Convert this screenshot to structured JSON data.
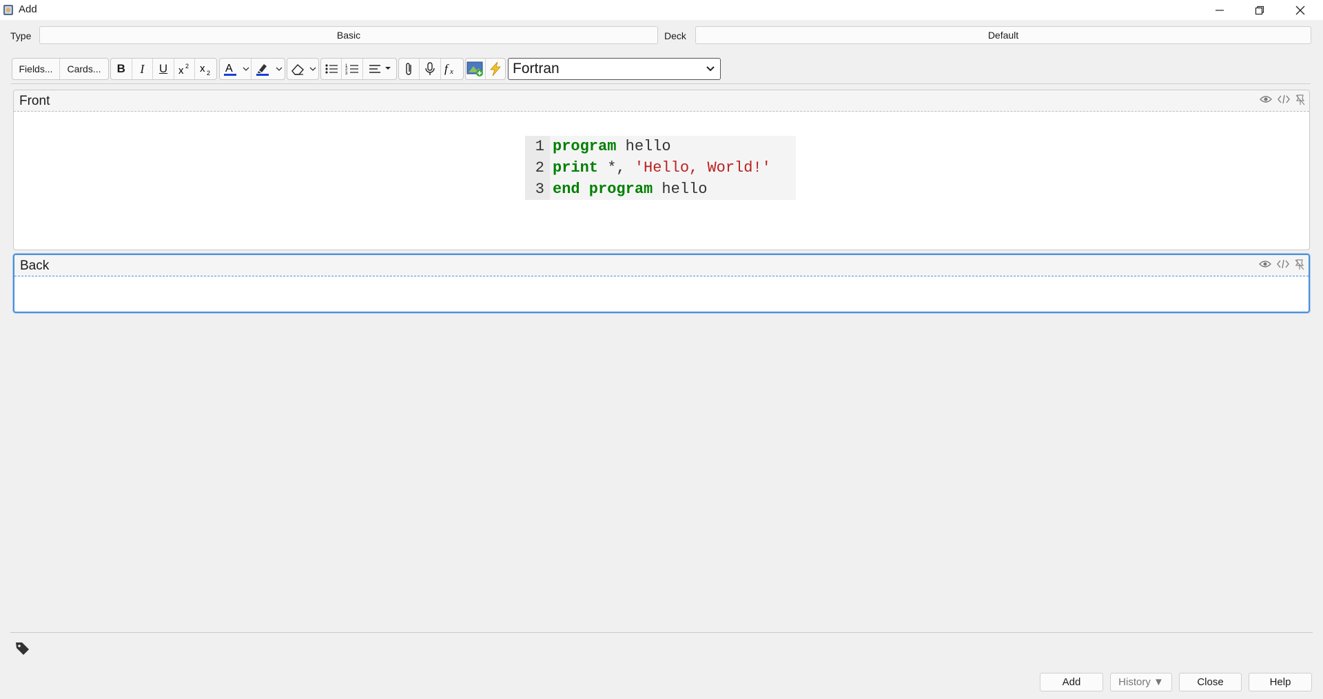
{
  "window": {
    "title": "Add",
    "controls": {
      "minimize": "minimize-icon",
      "restore": "restore-icon",
      "close": "close-icon"
    }
  },
  "chooser": {
    "type_label": "Type",
    "type_value": "Basic",
    "deck_label": "Deck",
    "deck_value": "Default"
  },
  "toolbar": {
    "fields_label": "Fields...",
    "cards_label": "Cards...",
    "bold": "B",
    "italic": "I",
    "underline": "U",
    "text_color": "#1c3fd4",
    "highlight_color": "#1c3fd4",
    "language_select": "Fortran"
  },
  "fields": {
    "front": {
      "label": "Front",
      "code": {
        "line_numbers": [
          "1",
          "2",
          "3"
        ],
        "line1": {
          "kw": "program",
          "rest": " hello"
        },
        "line2": {
          "kw": "print",
          "rest": " *, ",
          "str": "'Hello, World!'"
        },
        "line3": {
          "kw": "end program",
          "rest": " hello"
        }
      }
    },
    "back": {
      "label": "Back",
      "value": ""
    }
  },
  "bottom": {
    "add": "Add",
    "history": "History ▼",
    "close": "Close",
    "help": "Help"
  },
  "colors": {
    "accent_focus": "#4a90d9",
    "code_keyword": "#008000",
    "code_string": "#ba2121"
  }
}
